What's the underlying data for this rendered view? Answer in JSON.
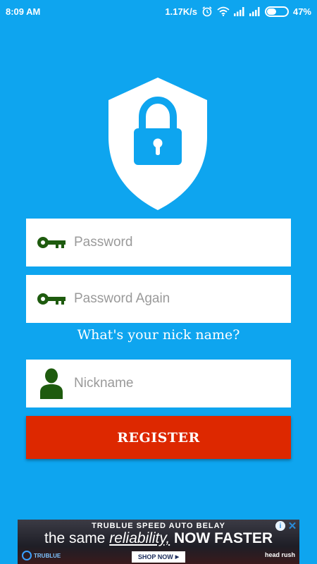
{
  "status_bar": {
    "time": "8:09 AM",
    "network_speed": "1.17K/s",
    "battery_percent": "47%",
    "battery_level": 0.47,
    "icons": [
      "alarm-icon",
      "wifi-icon",
      "signal-icon",
      "signal-icon",
      "battery-icon"
    ]
  },
  "form": {
    "password_placeholder": "Password",
    "password_again_placeholder": "Password Again",
    "nickname_prompt": "What's your nick name?",
    "nickname_placeholder": "Nickname",
    "register_label": "REGISTER"
  },
  "colors": {
    "background": "#0ea5ef",
    "icon_green": "#1e5b0e",
    "register_red": "#dd2800",
    "lock_blue": "#0ea5ef"
  },
  "ad": {
    "top_line": "TRUBLUE SPEED AUTO BELAY",
    "headline_part1": "the same ",
    "headline_part2": "reliability,",
    "headline_part3": " NOW FASTER",
    "brand_left": "TRUBLUE",
    "cta": "SHOP NOW",
    "brand_right": "head rush",
    "info_icon": "i",
    "close_icon": "✕"
  }
}
